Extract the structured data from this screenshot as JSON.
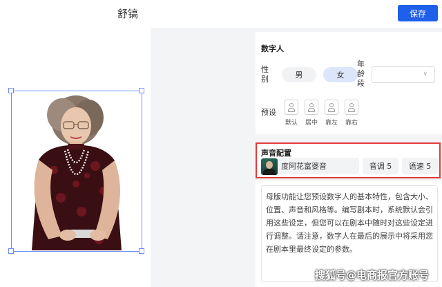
{
  "header": {
    "title": "舒镐",
    "save_label": "保存"
  },
  "digital_human": {
    "section_title": "数字人",
    "gender_label": "性别",
    "gender_options": [
      "男",
      "女"
    ],
    "gender_selected": "女",
    "age_label": "年龄段",
    "age_value": "",
    "preset_label": "预设",
    "presets": [
      "默认",
      "居中",
      "靠左",
      "靠右"
    ]
  },
  "voice": {
    "section_title": "声音配置",
    "voice_name": "度阿花富婆音",
    "pitch_label": "音调 5",
    "speed_label": "语速 5"
  },
  "script_text": "母版功能让您预设数字人的基本特性，包含大小、位置、声音和风格等。编写剧本时，系统默认会引用这些设定，但您可以在剧本中随时对这些设定进行调整。请注意，数字人在最后的展示中将采用您在剧本里最终设定的参数。",
  "watermark": "搜狐号@电商报官方账号",
  "colors": {
    "accent": "#1f5fea",
    "highlight_border": "#e23b3b",
    "selected_pill": "#dce6fb"
  },
  "icons": {
    "avatar": "person-portrait",
    "preset": "person-silhouette-icon",
    "chevron": "chevron-down-icon"
  }
}
